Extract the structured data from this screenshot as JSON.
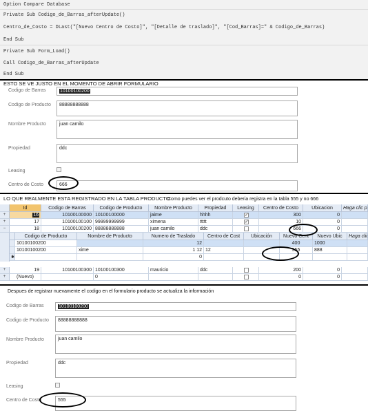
{
  "code": {
    "line1": "Option Compare Database",
    "line2": "Private Sub Codigo_de_Barras_afterUpdate()",
    "line3": "Centro_de_Costo = DLast(\"[Nuevo Centro de Costo]\", \"[Detalle de traslado]\", \"[Cod_Barras]=\" & Codigo_de_Barras)",
    "line4": "End Sub",
    "line5": "Private Sub Form_Load()",
    "line6": "Call Codigo_de_Barras_afterUpdate",
    "line7": "End Sub"
  },
  "form1": {
    "title": "ESTO SE VE JUSTO EN EL MOMENTO DE ABRIR FORMULARIO",
    "codigo_barras_label": "Codigo de Barras",
    "codigo_barras_value": "10100100200",
    "codigo_producto_label": "Codigo de Producto",
    "codigo_producto_value": "88888888888",
    "nombre_producto_label": "Nombre Producto",
    "nombre_producto_value": "juan camilo",
    "propiedad_label": "Propiedad",
    "propiedad_value": "ddc",
    "leasing_label": "Leasing",
    "centro_costo_label": "Centro de Costo",
    "centro_costo_value": "666"
  },
  "table": {
    "title": "LO QUE REALMENTE ESTA REGISTRADO EN LA TABLA  PRODUCTO",
    "note": "Como puedes ver el prodcuto deberia registra en la tabla 555 y no 666",
    "headers": [
      "Id",
      "Codigo de Barras",
      "Codigo de Producto",
      "Nombre Producto",
      "Propiedad",
      "Leasing",
      "Centro de Costo",
      "Ubicacion",
      "Haga clic para"
    ],
    "rows": [
      {
        "expand": "+",
        "id": "16",
        "barras": "10100100000",
        "producto": "10100100000",
        "nombre": "jaime",
        "propiedad": "hhhh",
        "leasing": true,
        "centro": "300",
        "ubicacion": "0"
      },
      {
        "expand": "+",
        "id": "17",
        "barras": "10100100100",
        "producto": "99999999999",
        "nombre": "ximena",
        "propiedad": "ttttt",
        "leasing": true,
        "centro": "10",
        "ubicacion": "0"
      },
      {
        "expand": "−",
        "id": "18",
        "barras": "10100100200",
        "producto": "88888888888",
        "nombre": "juan camilo",
        "propiedad": "ddc",
        "leasing": false,
        "centro": "666",
        "ubicacion": "0"
      }
    ],
    "sub_headers": [
      "Codigo de Producto",
      "Nombre de Producto",
      "Numero de Traslado",
      "Centro de Cost",
      "Ubicación",
      "Nuevo Cent",
      "Nuevo Ubic",
      "Haga clic"
    ],
    "sub_rows": [
      {
        "codigo": "10100100200",
        "nombre": "",
        "traslado": "12",
        "centro": "",
        "ubic": "",
        "nuevo_centro": "400",
        "nuevo_ubic": "1000"
      },
      {
        "codigo": "10100100200",
        "nombre": "xime",
        "traslado": "1 12",
        "centro": "12",
        "ubic": "",
        "nuevo_centro": "555",
        "nuevo_ubic": "888"
      },
      {
        "codigo": "",
        "nombre": "",
        "traslado": "0",
        "centro": "",
        "ubic": "",
        "nuevo_centro": "",
        "nuevo_ubic": ""
      }
    ],
    "row19": {
      "expand": "+",
      "id": "19",
      "barras": "10100100300",
      "producto": "10100100300",
      "nombre": "mauricio",
      "propiedad": "ddc",
      "centro": "200",
      "ubicacion": "0"
    },
    "new_row": {
      "expand": "+",
      "id": "(Nuevo)",
      "producto": "0",
      "centro": "0",
      "ubicacion": "0"
    }
  },
  "form2": {
    "title": "Despues de registrar nuevamente el codigo en el formulario producto se actualiza la información",
    "codigo_barras_label": "Codigo de Barras",
    "codigo_barras_value": "10100100200",
    "codigo_producto_label": "Codigo de Producto",
    "codigo_producto_value": "88888888888",
    "nombre_producto_label": "Nombre Producto",
    "nombre_producto_value": "juan camilo",
    "propiedad_label": "Propiedad",
    "propiedad_value": "ddc",
    "leasing_label": "Leasing",
    "centro_costo_label": "Centro de Costo",
    "centro_costo_value": "555"
  }
}
